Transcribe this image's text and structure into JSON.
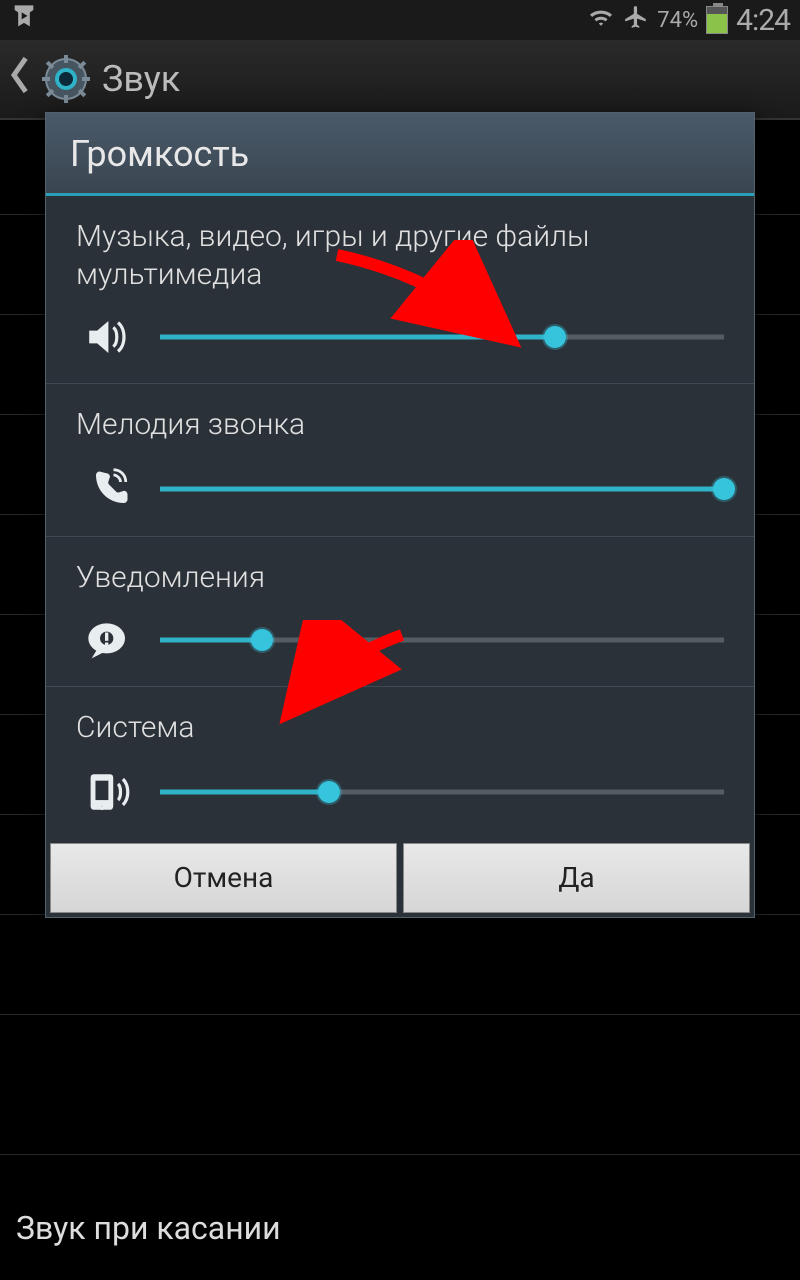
{
  "status": {
    "battery_pct": "74%",
    "time": "4:24"
  },
  "action_bar": {
    "title": "Звук"
  },
  "background_last_row": "Звук при касании",
  "dialog": {
    "title": "Громкость",
    "sections": [
      {
        "label": "Музыка, видео, игры и другие файлы мультимедиа",
        "value_pct": 70,
        "icon": "speaker"
      },
      {
        "label": "Мелодия звонка",
        "value_pct": 100,
        "icon": "phone"
      },
      {
        "label": "Уведомления",
        "value_pct": 18,
        "icon": "notification"
      },
      {
        "label": "Система",
        "value_pct": 30,
        "icon": "device"
      }
    ],
    "buttons": {
      "cancel": "Отмена",
      "ok": "Да"
    }
  },
  "colors": {
    "accent": "#2fb3c9",
    "arrow": "#ff0000"
  }
}
